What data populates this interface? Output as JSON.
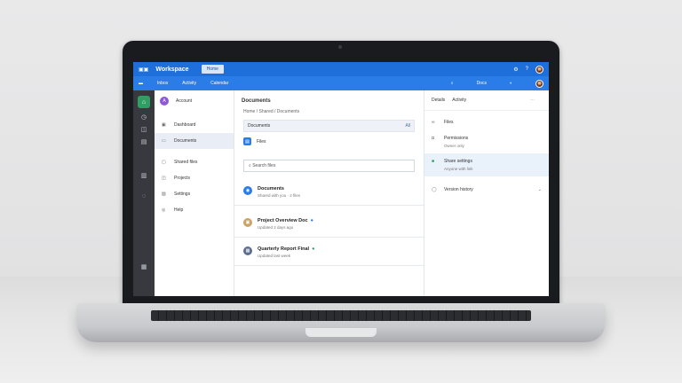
{
  "topbar": {
    "logo": "▣▣",
    "brand": "Workspace",
    "pill": "Home"
  },
  "navbar": {
    "items": [
      "Inbox",
      "Activity",
      "Calendar",
      "Docs"
    ]
  },
  "sidebar": {
    "user_initial": "A",
    "user_label": "Account",
    "items": [
      {
        "label": "Dashboard",
        "icon": "grid-icon"
      },
      {
        "label": "Documents",
        "icon": "folder-icon"
      },
      {
        "label": "Shared files",
        "icon": "share-icon"
      },
      {
        "label": "Projects",
        "icon": "layers-icon"
      },
      {
        "label": "Settings",
        "icon": "gear-icon"
      }
    ]
  },
  "main": {
    "title": "Documents",
    "breadcrumb": "Home  /  Shared  /  Documents",
    "subbar_label": "Documents",
    "subbar_right": "All",
    "row_label": "Files",
    "search_placeholder": "Search files",
    "entries": [
      {
        "title": "Documents",
        "sub": "Shared with you · 2 files"
      },
      {
        "title": "Project Overview Doc",
        "sub": "Updated 2 days ago"
      },
      {
        "title": "Quarterly Report Final",
        "sub": "Updated last week"
      }
    ]
  },
  "panel": {
    "tabs": [
      "Details",
      "Activity"
    ],
    "items": [
      {
        "label": "Files",
        "sub": ""
      },
      {
        "label": "Permissions",
        "sub": "Owner only"
      },
      {
        "label": "Share settings",
        "sub": "Anyone with link"
      },
      {
        "label": "Version history",
        "sub": ""
      }
    ]
  },
  "colors": {
    "brand": "#1e6fd9",
    "accent_green": "#2f9e63",
    "avatar_purple": "#8e58d8"
  }
}
